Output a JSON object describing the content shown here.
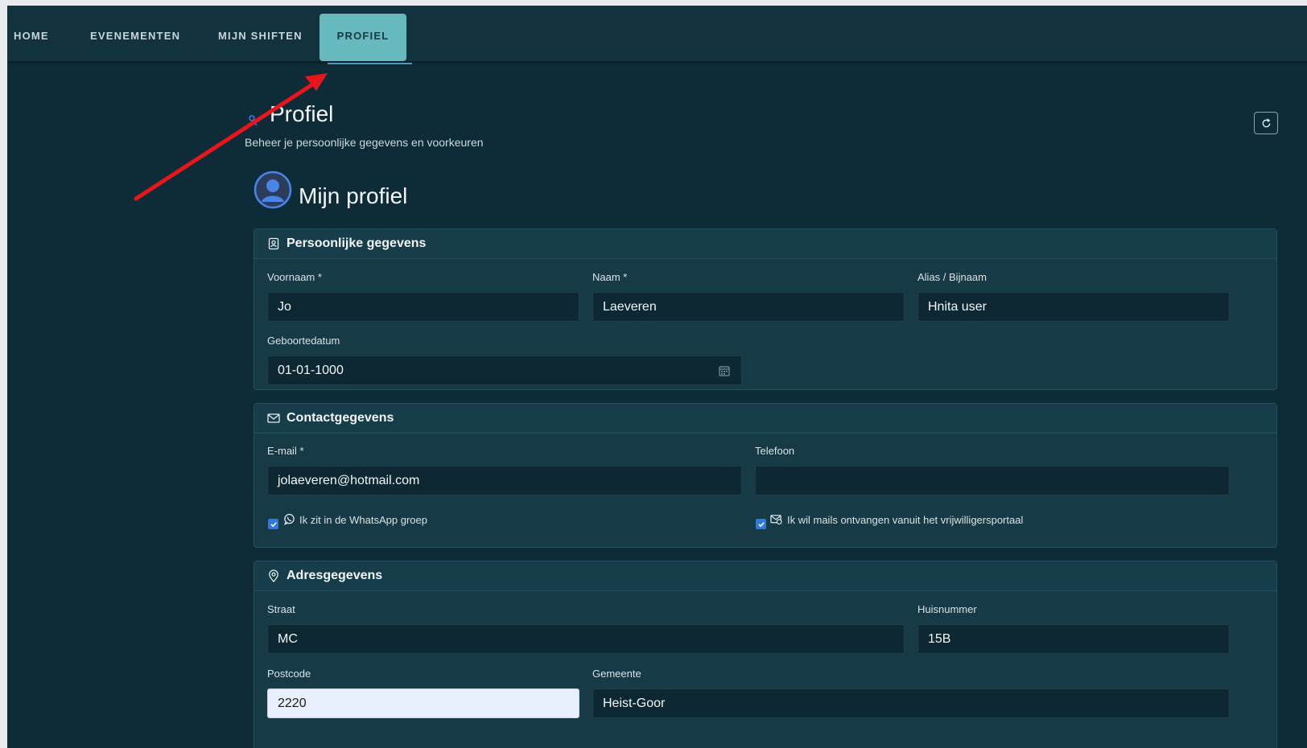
{
  "nav": {
    "items": [
      {
        "label": "HOME"
      },
      {
        "label": "EVENEMENTEN"
      },
      {
        "label": "MIJN SHIFTEN"
      },
      {
        "label": "PROFIEL",
        "active": true
      }
    ]
  },
  "header": {
    "title": "Profiel",
    "subtitle": "Beheer je persoonlijke gegevens en voorkeuren",
    "refresh_icon": "refresh-icon"
  },
  "profile": {
    "heading": "Mijn profiel",
    "avatar_icon": "user-circle-icon"
  },
  "personal": {
    "title": "Persoonlijke gegevens",
    "icon": "id-card-icon",
    "first_name_label": "Voornaam *",
    "first_name": "Jo",
    "last_name_label": "Naam *",
    "last_name": "Laeveren",
    "alias_label": "Alias / Bijnaam",
    "alias": "Hnita user",
    "birthdate_label": "Geboortedatum",
    "birthdate": "01-01-1000"
  },
  "contact": {
    "title": "Contactgegevens",
    "icon": "envelope-icon",
    "email_label": "E-mail *",
    "email": "jolaeveren@hotmail.com",
    "phone_label": "Telefoon",
    "phone": "",
    "whatsapp_label": "Ik zit in de WhatsApp groep",
    "whatsapp_checked": true,
    "mails_label": "Ik wil mails ontvangen vanuit het vrijwilligersportaal",
    "mails_checked": true
  },
  "address": {
    "title": "Adresgegevens",
    "icon": "map-pin-icon",
    "street_label": "Straat",
    "street": "MC",
    "number_label": "Huisnummer",
    "number": "15B",
    "postcode_label": "Postcode",
    "postcode": "2220",
    "city_label": "Gemeente",
    "city": "Heist-Goor"
  },
  "colors": {
    "background": "#0d2c38",
    "navbar": "#12323e",
    "active_tab": "#66b9bc",
    "annotation_arrow": "#e8161b",
    "checkbox": "#2e78e6"
  }
}
